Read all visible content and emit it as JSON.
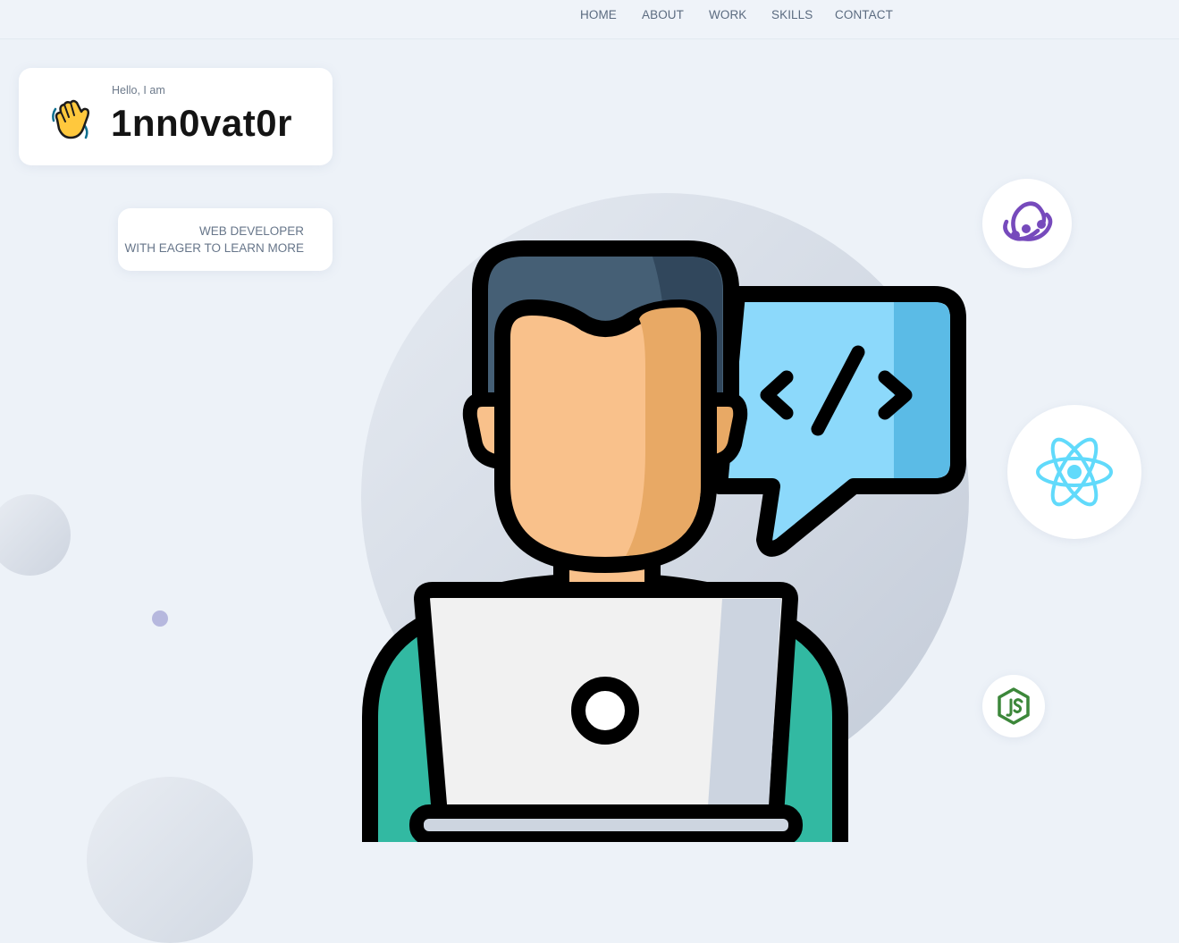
{
  "nav": {
    "items": [
      "HOME",
      "ABOUT",
      "WORK",
      "SKILLS",
      "CONTACT"
    ]
  },
  "intro": {
    "greeting": "Hello, I am",
    "name": "1nn0vat0r",
    "wave_icon": "waving-hand-icon"
  },
  "role": {
    "line1": "WEB DEVELOPER",
    "line2": "WITH EAGER TO LEARN MORE"
  },
  "tech_icons": [
    "redux-icon",
    "react-icon",
    "nodejs-icon"
  ],
  "colors": {
    "background": "#edf2f8",
    "nav_text": "#5b6b80",
    "name_text": "#141414",
    "redux": "#764abc",
    "react": "#61dafb",
    "nodejs": "#3c873a",
    "shirt": "#32b9a2",
    "skin": "#f9c18b",
    "hair": "#455f75",
    "speech_bubble": "#8cd9fb"
  }
}
